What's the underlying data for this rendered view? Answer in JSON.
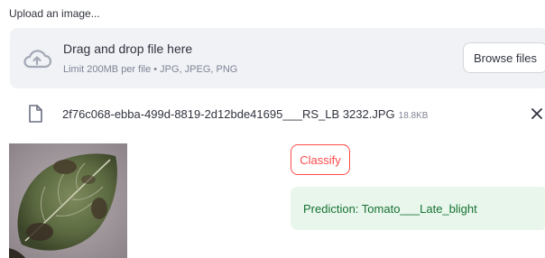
{
  "uploader": {
    "label": "Upload an image...",
    "drop_title": "Drag and drop file here",
    "limit_text": "Limit 200MB per file • JPG, JPEG, PNG",
    "browse_label": "Browse files",
    "icon": "cloud-upload-icon"
  },
  "file": {
    "name": "2f76c068-ebba-499d-8819-2d12bde41695___RS_LB 3232.JPG",
    "size": "18.8KB",
    "icon": "file-icon",
    "remove_icon": "close-icon"
  },
  "classify_button": {
    "label": "Classify"
  },
  "prediction": {
    "text": "Prediction: Tomato___Late_blight"
  },
  "colors": {
    "accent": "#ff4b4b",
    "success_bg": "#e8f6ec",
    "success_text": "#177233",
    "dropzone_bg": "#f0f2f6"
  }
}
